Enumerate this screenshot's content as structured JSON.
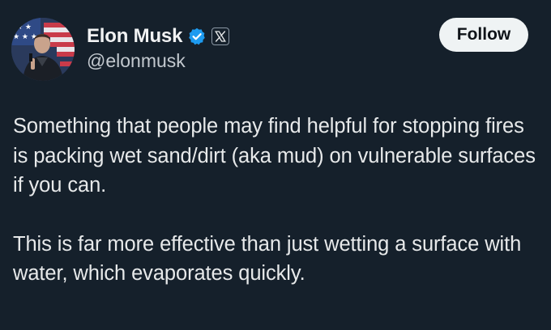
{
  "author": {
    "display_name": "Elon Musk",
    "handle": "@elonmusk",
    "verified_icon": "verified-badge-icon",
    "affiliation_icon": "x-logo-icon",
    "verified_color": "#1d9bf0"
  },
  "actions": {
    "follow_label": "Follow"
  },
  "tweet": {
    "paragraphs": [
      "Something that people may find helpful for stopping fires is packing wet sand/dirt (aka mud) on vulnerable surfaces if you can.",
      "This is far more effective than just wetting a surface with water, which evaporates quickly."
    ]
  },
  "colors": {
    "background": "#15202b",
    "text": "#e7e9ea",
    "secondary_text": "#c3c9cf",
    "button_bg": "#eff3f4",
    "button_text": "#0f1419"
  }
}
